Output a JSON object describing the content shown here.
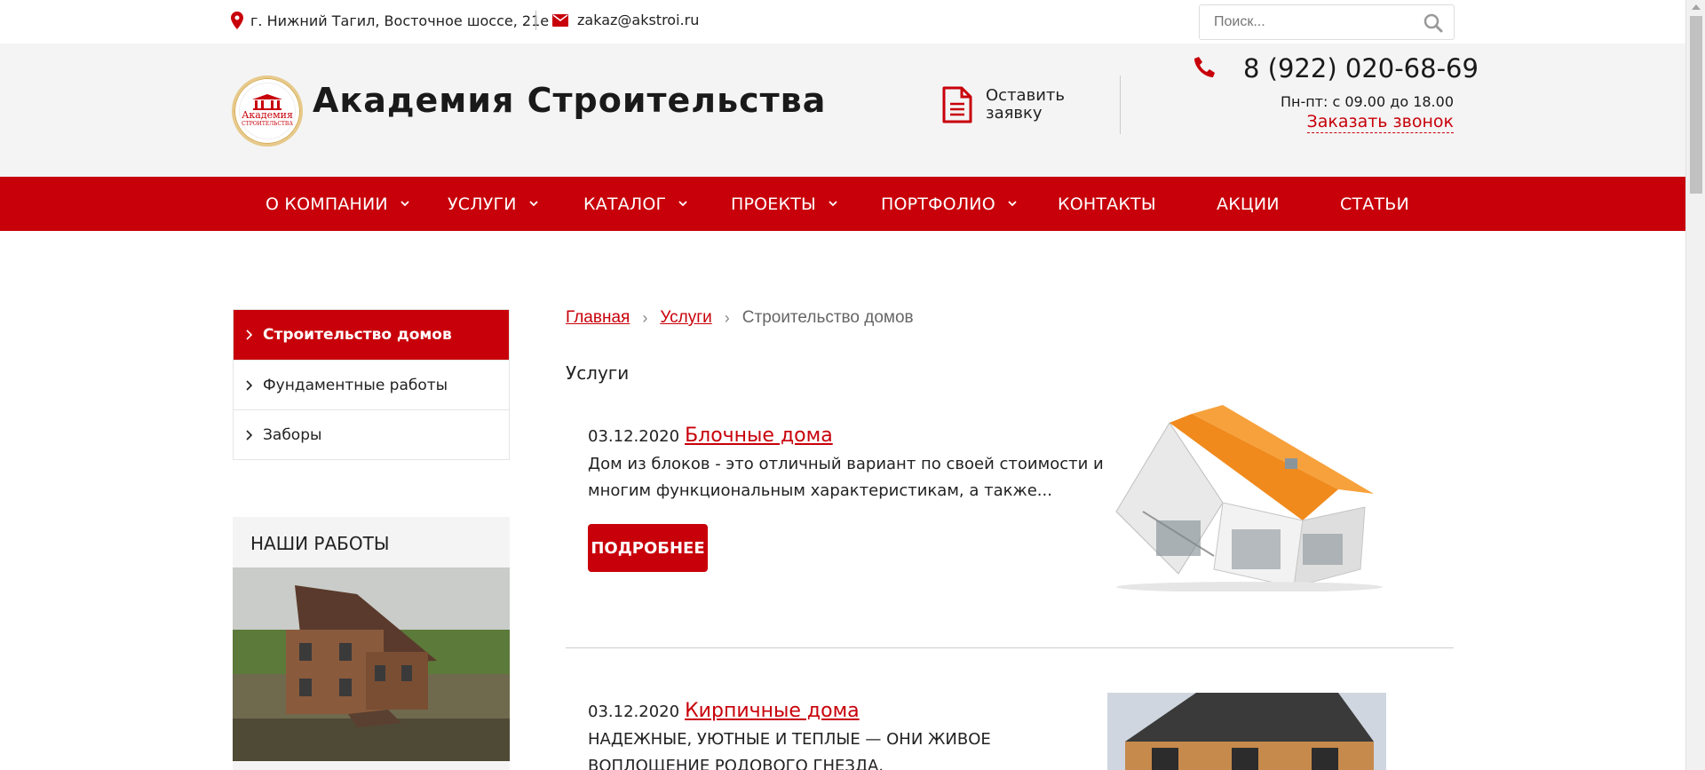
{
  "topbar": {
    "address": "г. Нижний Тагил, Восточное шоссе, 21е",
    "email": "zakaz@akstroi.ru",
    "search_placeholder": "Поиск..."
  },
  "header": {
    "logo_line1": "Академия",
    "logo_line2": "СТРОИТЕЛЬСТВА",
    "site_name": "Академия Строительства",
    "request_label": "Оставить заявку",
    "phone": "8 (922) 020-68-69",
    "hours": "Пн-пт: с 09.00 до 18.00",
    "callback": "Заказать звонок"
  },
  "nav": {
    "items": [
      {
        "label": "О КОМПАНИИ",
        "has_dropdown": true
      },
      {
        "label": "УСЛУГИ",
        "has_dropdown": true
      },
      {
        "label": "КАТАЛОГ",
        "has_dropdown": true
      },
      {
        "label": "ПРОЕКТЫ",
        "has_dropdown": true
      },
      {
        "label": "ПОРТФОЛИО",
        "has_dropdown": true
      },
      {
        "label": "КОНТАКТЫ",
        "has_dropdown": false
      },
      {
        "label": "АКЦИИ",
        "has_dropdown": false
      },
      {
        "label": "СТАТЬИ",
        "has_dropdown": false
      }
    ]
  },
  "sidebar": {
    "items": [
      {
        "label": "Строительство домов",
        "active": true
      },
      {
        "label": "Фундаментные работы",
        "active": false
      },
      {
        "label": "Заборы",
        "active": false
      }
    ],
    "works_title": "НАШИ РАБОТЫ"
  },
  "main": {
    "breadcrumb": [
      "Главная",
      "Услуги",
      "Строительство домов"
    ],
    "section_title": "Услуги",
    "cards": [
      {
        "date": "03.12.2020",
        "title": "Блочные дома",
        "description": "Дом из блоков - это отличный вариант по своей стоимости и многим функциональным характеристикам, а также...",
        "button": "ПОДРОБНЕЕ"
      },
      {
        "date": "03.12.2020",
        "title": "Кирпичные дома",
        "description": "НАДЕЖНЫЕ, УЮТНЫЕ И ТЕПЛЫЕ — ОНИ ЖИВОЕ ВОПЛОЩЕНИЕ РОДОВОГО ГНЕЗДА."
      }
    ]
  },
  "colors": {
    "brand_red": "#c8000a",
    "header_bg": "#f4f4f4"
  }
}
